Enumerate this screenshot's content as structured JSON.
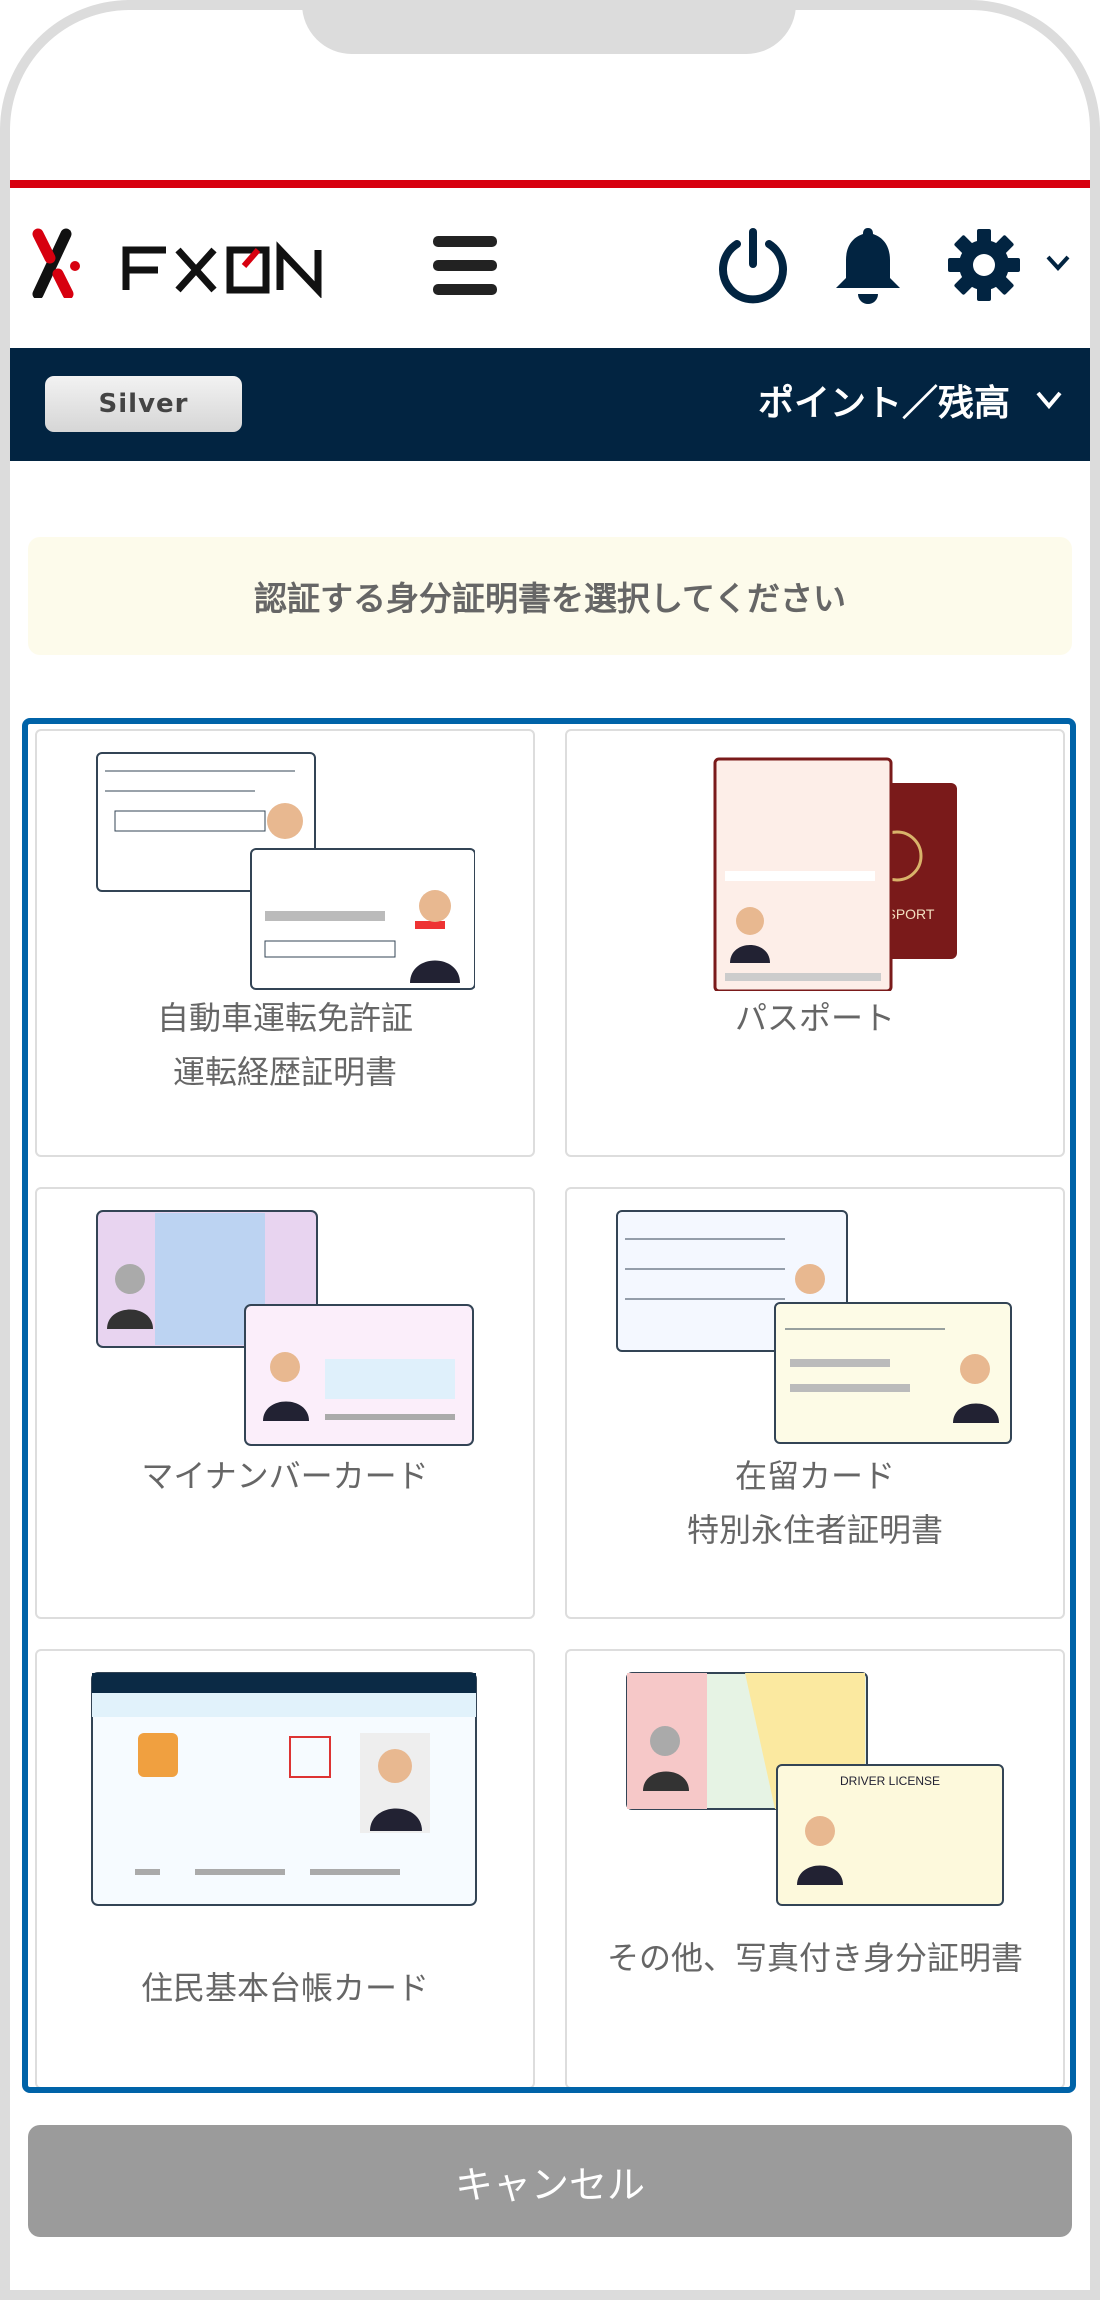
{
  "header": {
    "logo_text": "FXON",
    "icons": [
      "hamburger-menu-icon",
      "power-icon",
      "bell-icon",
      "gear-icon",
      "chevron-down-icon"
    ]
  },
  "account_bar": {
    "rank": "Silver",
    "points_label": "ポイント／残高"
  },
  "notice": "認証する身分証明書を選択してください",
  "documents": [
    {
      "line1": "自動車運転免許証",
      "line2": "運転経歴証明書"
    },
    {
      "line1": "パスポート",
      "line2": ""
    },
    {
      "line1": "マイナンバーカード",
      "line2": ""
    },
    {
      "line1": "在留カード",
      "line2": "特別永住者証明書"
    },
    {
      "line1": "住民基本台帳カード",
      "line2": ""
    },
    {
      "line1": "その他、写真付き身分証明書",
      "line2": ""
    }
  ],
  "cancel_label": "キャンセル",
  "colors": {
    "accent_red": "#d7000f",
    "navy": "#022441",
    "border_blue": "#0063a8",
    "cancel_gray": "#9b9b9b"
  }
}
